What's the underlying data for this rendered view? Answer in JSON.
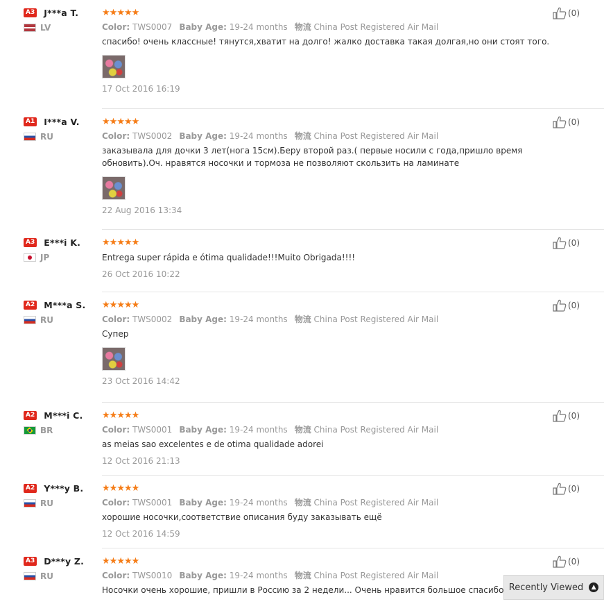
{
  "labels": {
    "color": "Color:",
    "baby_age": "Baby Age:",
    "shipping": "物流"
  },
  "reviews": [
    {
      "level": "A3",
      "name": "J***a T.",
      "flag": "lv",
      "country": "LV",
      "stars": 5,
      "color": "TWS0007",
      "age": "19-24 months",
      "shipping": "China Post Registered Air Mail",
      "text": "спасибо! очень классные! тянутся,хватит на долго! жалко доставка такая долгая,но они стоят того.",
      "has_image": true,
      "date": "17 Oct 2016 16:19",
      "helpful": "(0)"
    },
    {
      "level": "A1",
      "name": "I***a V.",
      "flag": "ru",
      "country": "RU",
      "stars": 5,
      "color": "TWS0002",
      "age": "19-24 months",
      "shipping": "China Post Registered Air Mail",
      "text": "заказывала для дочки 3 лет(нога 15см).Беру второй раз.( первые носили с года,пришло время обновить).Оч. нравятся носочки и тормоза не позволяют скользить на ламинате",
      "has_image": true,
      "date": "22 Aug 2016 13:34",
      "helpful": "(0)"
    },
    {
      "level": "A3",
      "name": "E***i K.",
      "flag": "jp",
      "country": "JP",
      "stars": 5,
      "color": null,
      "age": null,
      "shipping": null,
      "text": "Entrega super rápida e ótima qualidade!!!Muito Obrigada!!!!",
      "has_image": false,
      "date": "26 Oct 2016 10:22",
      "helpful": "(0)"
    },
    {
      "level": "A2",
      "name": "M***a S.",
      "flag": "ru",
      "country": "RU",
      "stars": 5,
      "color": "TWS0002",
      "age": "19-24 months",
      "shipping": "China Post Registered Air Mail",
      "text": "Супер",
      "has_image": true,
      "date": "23 Oct 2016 14:42",
      "helpful": "(0)"
    },
    {
      "level": "A2",
      "name": "M***i C.",
      "flag": "br",
      "country": "BR",
      "stars": 5,
      "color": "TWS0001",
      "age": "19-24 months",
      "shipping": "China Post Registered Air Mail",
      "text": "as meias sao excelentes e de otima qualidade adorei",
      "has_image": false,
      "date": "12 Oct 2016 21:13",
      "helpful": "(0)"
    },
    {
      "level": "A2",
      "name": "Y***y B.",
      "flag": "ru",
      "country": "RU",
      "stars": 5,
      "color": "TWS0001",
      "age": "19-24 months",
      "shipping": "China Post Registered Air Mail",
      "text": "хорошие носочки,соответствие описания буду заказывать ещё",
      "has_image": false,
      "date": "12 Oct 2016 14:59",
      "helpful": "(0)"
    },
    {
      "level": "A3",
      "name": "D***y Z.",
      "flag": "ru",
      "country": "RU",
      "stars": 5,
      "color": "TWS0010",
      "age": "19-24 months",
      "shipping": "China Post Registered Air Mail",
      "text": "Носочки очень хорошие, пришли в Россию за 2 недели... Очень нравится большое спасибо",
      "has_image": false,
      "date": "",
      "helpful": "(0)"
    }
  ],
  "recently_viewed": "Recently Viewed"
}
